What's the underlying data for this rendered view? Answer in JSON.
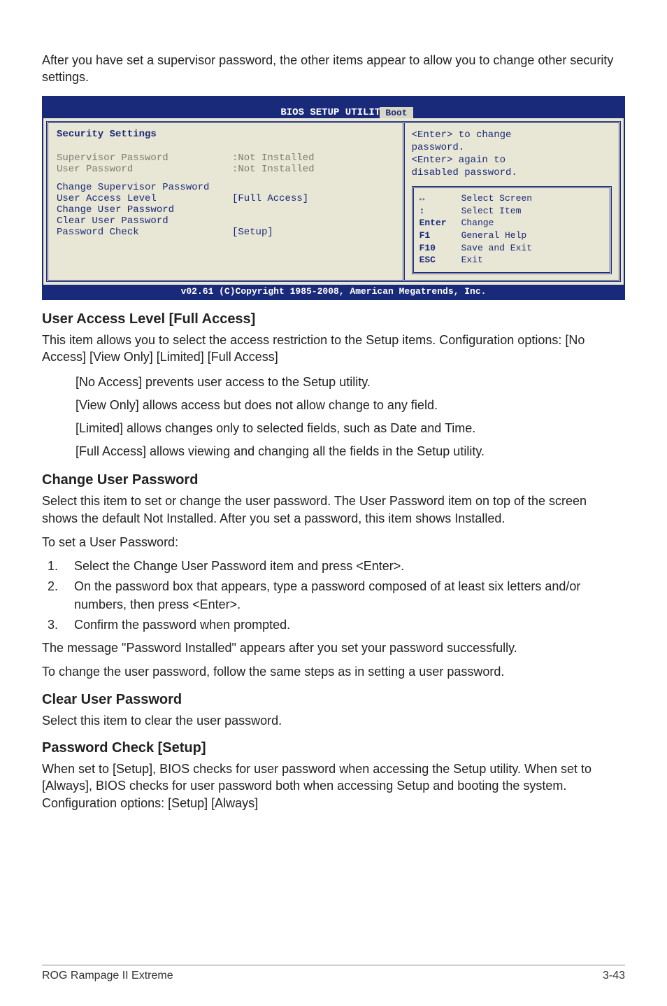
{
  "intro": "After you have set a supervisor password, the other items appear to allow you to change other security settings.",
  "bios": {
    "title": "BIOS SETUP UTILITY",
    "tab": "Boot",
    "panel_heading": "Security Settings",
    "rows": {
      "supervisor_label": "Supervisor Password",
      "supervisor_val": ":Not Installed",
      "user_label": "User Password",
      "user_val": ":Not Installed",
      "chg_super": "Change Supervisor Password",
      "ual_label": "User Access Level",
      "ual_val": "[Full Access]",
      "chg_user": "Change User Password",
      "clr_user": "Clear User Password",
      "pwc_label": "Password Check",
      "pwc_val": "[Setup]"
    },
    "help": {
      "line1": "<Enter> to change",
      "line2": "password.",
      "line3": "<Enter> again to",
      "line4": "disabled password."
    },
    "legend": {
      "select_screen": "Select Screen",
      "select_item": "Select Item",
      "enter_key": "Enter",
      "enter_txt": "Change",
      "f1_key": "F1",
      "f1_txt": "General Help",
      "f10_key": "F10",
      "f10_txt": "Save and Exit",
      "esc_key": "ESC",
      "esc_txt": "Exit"
    },
    "footer": "v02.61 (C)Copyright 1985-2008, American Megatrends, Inc."
  },
  "s1": {
    "heading": "User Access Level [Full Access]",
    "p1": "This item allows you to select the access restriction to the Setup items. Configuration options: [No Access] [View Only] [Limited] [Full Access]",
    "b1": "[No Access] prevents user access to the Setup utility.",
    "b2": "[View Only] allows access but does not allow change to any field.",
    "b3": "[Limited] allows changes only to selected fields, such as Date and Time.",
    "b4": "[Full Access] allows viewing and changing all the fields in the Setup utility."
  },
  "s2": {
    "heading": "Change User Password",
    "p1": "Select this item to set or change the user password. The User Password item on top of the screen shows the default Not Installed. After you set a password, this item shows Installed.",
    "p2": "To set a User Password:",
    "steps": {
      "a": "Select the Change User Password item and press <Enter>.",
      "b": "On the password box that appears, type a password composed of at least six letters and/or numbers, then press <Enter>.",
      "c": "Confirm the password when prompted."
    },
    "p3": "The message \"Password Installed\" appears after you set your password successfully.",
    "p4": "To change the user password, follow the same steps as in setting a user password."
  },
  "s3": {
    "heading": "Clear User Password",
    "p1": "Select this item to clear the user password."
  },
  "s4": {
    "heading": "Password Check [Setup]",
    "p1": "When set to [Setup], BIOS checks for user password when accessing the Setup utility. When set to [Always], BIOS checks for user password both when accessing Setup and booting the system. Configuration options: [Setup] [Always]"
  },
  "footer": {
    "left": "ROG Rampage II Extreme",
    "right": "3-43"
  }
}
